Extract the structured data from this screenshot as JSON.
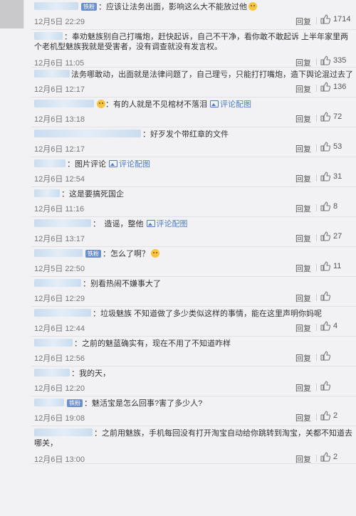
{
  "actions": {
    "reply_label": "回复",
    "image_comment_label": "评论配图"
  },
  "colors": {
    "link": "#4d7cc3",
    "badge": "#6b8fc9",
    "background": "#f2f2f5",
    "time": "#777777"
  },
  "comments": [
    {
      "name_w": 62,
      "badge": "铁粉",
      "text": "：应该让法务出面，影响这么大不能放过他",
      "emoji": true,
      "time": "12月5日 22:29",
      "likes": "1714",
      "tall": false
    },
    {
      "name_w": 40,
      "text": "：奉劝魅族别自己打嘴炮，赶快起诉，自己不干净，看你敢不敢起诉 上半年家里两个老机型魅族我就是受害者，没有调查就没有发言权。",
      "time": "12月6日 11:05",
      "likes": "335",
      "tall": true
    },
    {
      "name_w": 50,
      "text": "法务哪敢动，出面就是法律问题了，自己理亏，只能打打嘴炮，造下舆论混过去了",
      "time": "12月6日 12:17",
      "likes": "136",
      "tall": false
    },
    {
      "name_w": 84,
      "emoji": true,
      "text": "：有的人就是不见棺材不落泪",
      "image_comment": true,
      "time": "12月6日 13:18",
      "likes": "72",
      "tall": false
    },
    {
      "name_w": 150,
      "text": "：好歹发个带红章的文件",
      "time": "12月6日 12:17",
      "likes": "53",
      "tall": false
    },
    {
      "name_w": 44,
      "text": "：图片评论",
      "image_comment": true,
      "time": "12月6日 12:54",
      "likes": "31",
      "tall": false
    },
    {
      "name_w": 36,
      "text": "：这是要搞死国企",
      "time": "12月6日 11:16",
      "likes": "8",
      "tall": false
    },
    {
      "name_w": 80,
      "text": "：　造谣，整他",
      "image_comment": true,
      "time": "12月6日 13:17",
      "likes": "27",
      "tall": false
    },
    {
      "name_w": 68,
      "badge": "铁粉",
      "text": "：怎么了啊？",
      "emoji": true,
      "time": "12月5日 22:50",
      "likes": "11",
      "tall": false
    },
    {
      "name_w": 66,
      "text": "：别看热闹不嫌事大了",
      "time": "12月6日 12:29",
      "likes": "",
      "tall": false
    },
    {
      "name_w": 80,
      "text": "：垃圾魅族 不知道做了多少类似这样的事情，能在这里声明你妈呢",
      "time": "12月6日 12:44",
      "likes": "4",
      "tall": false
    },
    {
      "name_w": 54,
      "text": "：之前的魅蓝确实有，现在不用了不知道咋样",
      "time": "12月6日 12:56",
      "likes": "",
      "tall": false
    },
    {
      "name_w": 50,
      "text": "：我的天，",
      "time": "12月6日 12:20",
      "likes": "",
      "tall": false
    },
    {
      "name_w": 42,
      "badge": "铁粉",
      "text": "：魅活宝是怎么回事?害了多少人?",
      "time": "12月6日 19:08",
      "likes": "2",
      "tall": false
    },
    {
      "name_w": 82,
      "text": "：之前用魅族，手机每回没有打开淘宝自动给你跳转到淘宝，关都不知道去哪关，",
      "time": "12月6日 13:00",
      "likes": "2",
      "tall": true
    }
  ]
}
